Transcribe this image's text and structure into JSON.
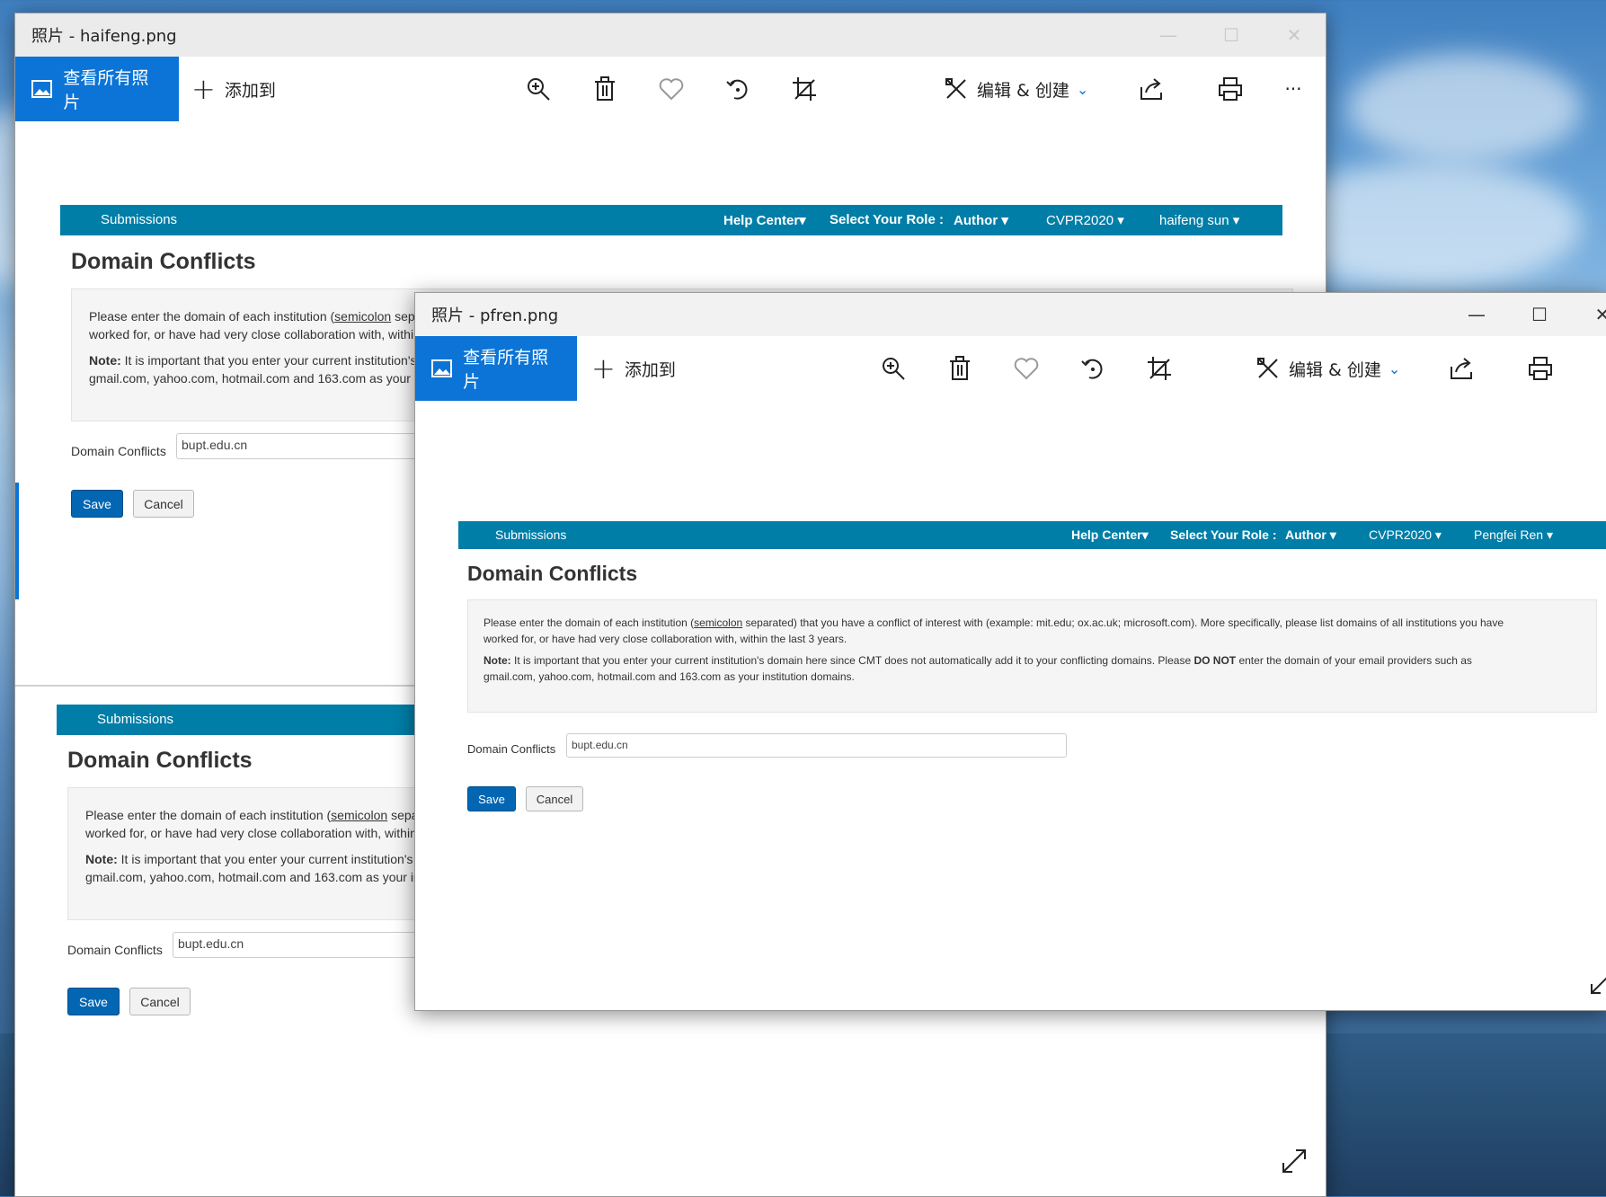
{
  "desktop": {
    "name": "desktop-background"
  },
  "window_back": {
    "title": "照片 - haifeng.png",
    "minimize": "—",
    "maximize": "☐",
    "close": "✕",
    "all_photos": "查看所有照片",
    "add_to": "添加到",
    "edit_create": "编辑 & 创建",
    "more": "···",
    "page": {
      "nav": {
        "submissions": "Submissions",
        "help": "Help Center▾",
        "role_label": "Select Your Role :",
        "role": "Author ▾",
        "conf": "CVPR2020 ▾",
        "user": "haifeng sun ▾"
      },
      "heading": "Domain Conflicts",
      "para1_pre": "Please enter the domain of each institution (",
      "para1_link": "semicolon",
      "para1_post": " separ",
      "para1_line2": "worked for, or have had very close collaboration with, within",
      "note_label": "Note:",
      "note_text": " It is important that you enter your current institution's d",
      "note_line2": "gmail.com, yahoo.com, hotmail.com and 163.com as your in",
      "field_label": "Domain Conflicts",
      "field_value": "bupt.edu.cn",
      "save": "Save",
      "cancel": "Cancel"
    },
    "page_lower": {
      "submissions": "Submissions",
      "heading": "Domain Conflicts",
      "para1_pre": "Please enter the domain of each institution (",
      "para1_link": "semicolon",
      "para1_post": " separa",
      "para1_line2": "worked for, or have had very close collaboration with, within t",
      "note_label": "Note:",
      "note_text": " It is important that you enter your current institution's do",
      "note_line2": "gmail.com, yahoo.com, hotmail.com and 163.com as your ins",
      "field_label": "Domain Conflicts",
      "field_value": "bupt.edu.cn",
      "save": "Save",
      "cancel": "Cancel"
    }
  },
  "window_front": {
    "title": "照片 - pfren.png",
    "minimize": "—",
    "maximize": "☐",
    "close": "✕",
    "all_photos": "查看所有照片",
    "add_to": "添加到",
    "edit_create": "编辑 & 创建",
    "page": {
      "nav": {
        "submissions": "Submissions",
        "help": "Help Center▾",
        "role_label": "Select Your Role :",
        "role": "Author ▾",
        "conf": "CVPR2020 ▾",
        "user": "Pengfei Ren ▾"
      },
      "heading": "Domain Conflicts",
      "para1_pre": "Please enter the domain of each institution (",
      "para1_link": "semicolon",
      "para1_post": " separated) that you have a conflict of interest with (example: mit.edu; ox.ac.uk; microsoft.com). More specifically, please list domains of all institutions you have",
      "para1_line2": "worked for, or have had very close collaboration with, within the last 3 years.",
      "note_label": "Note:",
      "note_text": " It is important that you enter your current institution's domain here since CMT does not automatically add it to your conflicting domains. Please ",
      "note_bold": "DO NOT",
      "note_tail": " enter the domain of your email providers such as",
      "note_line2": "gmail.com, yahoo.com, hotmail.com and 163.com as your institution domains.",
      "field_label": "Domain Conflicts",
      "field_value": "bupt.edu.cn",
      "save": "Save",
      "cancel": "Cancel"
    }
  },
  "colors": {
    "accent": "#0b74d6",
    "nav": "#007ea7",
    "save": "#0266b3"
  }
}
